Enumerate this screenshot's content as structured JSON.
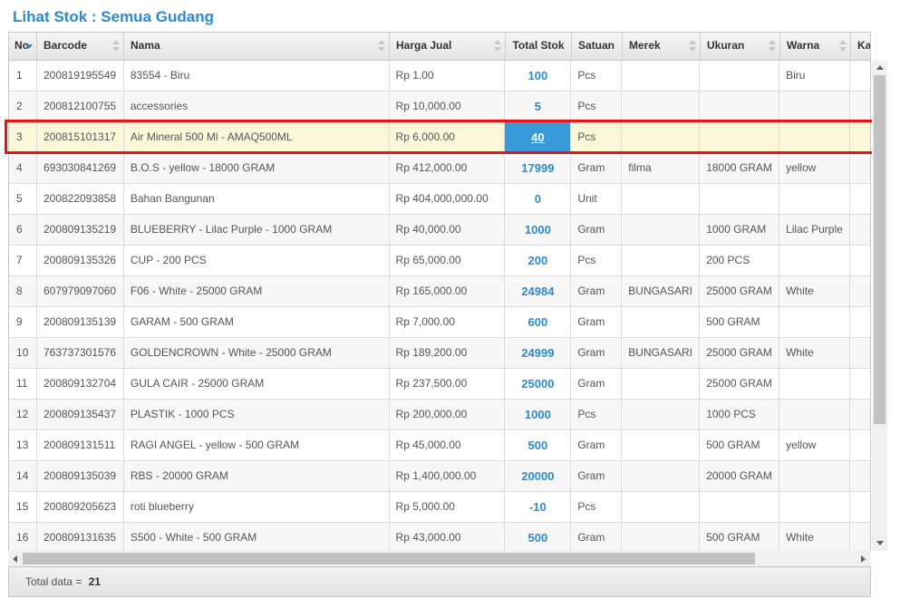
{
  "title": "Lihat Stok : Semua Gudang",
  "columns": [
    "No",
    "Barcode",
    "Nama",
    "Harga Jual",
    "Total Stok",
    "Satuan",
    "Merek",
    "Ukuran",
    "Warna",
    "Kateg"
  ],
  "rows": [
    {
      "no": "1",
      "barcode": "200819195549",
      "nama": "83554 - Biru",
      "harga": "Rp 1.00",
      "stok": "100",
      "satuan": "Pcs",
      "merek": "",
      "ukuran": "",
      "warna": "Biru"
    },
    {
      "no": "2",
      "barcode": "200812100755",
      "nama": "accessories",
      "harga": "Rp 10,000.00",
      "stok": "5",
      "satuan": "Pcs",
      "merek": "",
      "ukuran": "",
      "warna": ""
    },
    {
      "no": "3",
      "barcode": "200815101317",
      "nama": "Air Mineral 500 Ml - AMAQ500ML",
      "harga": "Rp 6,000.00",
      "stok": "40",
      "satuan": "Pcs",
      "merek": "",
      "ukuran": "",
      "warna": ""
    },
    {
      "no": "4",
      "barcode": "693030841269",
      "nama": "B.O.S - yellow - 18000 GRAM",
      "harga": "Rp 412,000.00",
      "stok": "17999",
      "satuan": "Gram",
      "merek": "filma",
      "ukuran": "18000 GRAM",
      "warna": "yellow"
    },
    {
      "no": "5",
      "barcode": "200822093858",
      "nama": "Bahan Bangunan",
      "harga": "Rp 404,000,000.00",
      "stok": "0",
      "satuan": "Unit",
      "merek": "",
      "ukuran": "",
      "warna": ""
    },
    {
      "no": "6",
      "barcode": "200809135219",
      "nama": "BLUEBERRY - Lilac Purple - 1000 GRAM",
      "harga": "Rp 40,000.00",
      "stok": "1000",
      "satuan": "Gram",
      "merek": "",
      "ukuran": "1000 GRAM",
      "warna": "Lilac Purple"
    },
    {
      "no": "7",
      "barcode": "200809135326",
      "nama": "CUP - 200 PCS",
      "harga": "Rp 65,000.00",
      "stok": "200",
      "satuan": "Pcs",
      "merek": "",
      "ukuran": "200 PCS",
      "warna": ""
    },
    {
      "no": "8",
      "barcode": "607979097060",
      "nama": "F06 - White - 25000 GRAM",
      "harga": "Rp 165,000.00",
      "stok": "24984",
      "satuan": "Gram",
      "merek": "BUNGASARI",
      "ukuran": "25000 GRAM",
      "warna": "White"
    },
    {
      "no": "9",
      "barcode": "200809135139",
      "nama": "GARAM - 500 GRAM",
      "harga": "Rp 7,000.00",
      "stok": "600",
      "satuan": "Gram",
      "merek": "",
      "ukuran": "500 GRAM",
      "warna": ""
    },
    {
      "no": "10",
      "barcode": "763737301576",
      "nama": "GOLDENCROWN - White - 25000 GRAM",
      "harga": "Rp 189,200.00",
      "stok": "24999",
      "satuan": "Gram",
      "merek": "BUNGASARI",
      "ukuran": "25000 GRAM",
      "warna": "White"
    },
    {
      "no": "11",
      "barcode": "200809132704",
      "nama": "GULA CAIR - 25000 GRAM",
      "harga": "Rp 237,500.00",
      "stok": "25000",
      "satuan": "Gram",
      "merek": "",
      "ukuran": "25000 GRAM",
      "warna": ""
    },
    {
      "no": "12",
      "barcode": "200809135437",
      "nama": "PLASTIK - 1000 PCS",
      "harga": "Rp 200,000.00",
      "stok": "1000",
      "satuan": "Pcs",
      "merek": "",
      "ukuran": "1000 PCS",
      "warna": ""
    },
    {
      "no": "13",
      "barcode": "200809131511",
      "nama": "RAGI ANGEL - yellow - 500 GRAM",
      "harga": "Rp 45,000.00",
      "stok": "500",
      "satuan": "Gram",
      "merek": "",
      "ukuran": "500 GRAM",
      "warna": "yellow"
    },
    {
      "no": "14",
      "barcode": "200809135039",
      "nama": "RBS - 20000 GRAM",
      "harga": "Rp 1,400,000.00",
      "stok": "20000",
      "satuan": "Gram",
      "merek": "",
      "ukuran": "20000 GRAM",
      "warna": ""
    },
    {
      "no": "15",
      "barcode": "200809205623",
      "nama": "roti blueberry",
      "harga": "Rp 5,000.00",
      "stok": "-10",
      "satuan": "Pcs",
      "merek": "",
      "ukuran": "",
      "warna": ""
    },
    {
      "no": "16",
      "barcode": "200809131635",
      "nama": "S500 - White - 500 GRAM",
      "harga": "Rp 43,000.00",
      "stok": "500",
      "satuan": "Gram",
      "merek": "",
      "ukuran": "500 GRAM",
      "warna": "White"
    }
  ],
  "selected_row": 3,
  "footer": {
    "label": "Total data =",
    "count": "21"
  },
  "colors": {
    "accent": "#2b8ad0",
    "selected_bg": "#fdf8d9",
    "selected_cell": "#3a9ad9",
    "highlight": "#ee1111"
  }
}
